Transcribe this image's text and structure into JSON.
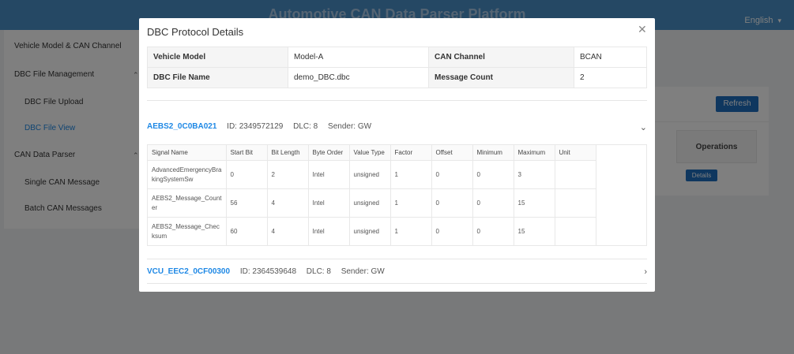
{
  "header": {
    "title": "Automotive CAN Data Parser Platform",
    "language": "English"
  },
  "sidebar": {
    "items": [
      {
        "label": "Vehicle Model & CAN Channel"
      },
      {
        "label": "DBC File Management"
      },
      {
        "label": "DBC File Upload"
      },
      {
        "label": "DBC File View"
      },
      {
        "label": "CAN Data Parser"
      },
      {
        "label": "Single CAN Message"
      },
      {
        "label": "Batch CAN Messages"
      }
    ]
  },
  "main": {
    "refresh_label": "Refresh",
    "operations_header": "Operations",
    "details_label": "Details"
  },
  "modal": {
    "title": "DBC Protocol Details",
    "info": {
      "vehicle_model_label": "Vehicle Model",
      "vehicle_model_value": "Model-A",
      "can_channel_label": "CAN Channel",
      "can_channel_value": "BCAN",
      "dbc_file_label": "DBC File Name",
      "dbc_file_value": "demo_DBC.dbc",
      "message_count_label": "Message Count",
      "message_count_value": "2"
    },
    "messages": [
      {
        "name": "AEBS2_0C0BA021",
        "id": "ID: 2349572129",
        "dlc": "DLC: 8",
        "sender": "Sender: GW"
      },
      {
        "name": "VCU_EEC2_0CF00300",
        "id": "ID: 2364539648",
        "dlc": "DLC: 8",
        "sender": "Sender: GW"
      }
    ],
    "signal_columns": [
      "Signal Name",
      "Start Bit",
      "Bit Length",
      "Byte Order",
      "Value Type",
      "Factor",
      "Offset",
      "Minimum",
      "Maximum",
      "Unit"
    ],
    "signals": [
      {
        "name1": "AdvancedEmergencyBra",
        "name2": "kingSystemSw",
        "start_bit": "0",
        "bit_length": "2",
        "byte_order": "Intel",
        "value_type": "unsigned",
        "factor": "1",
        "offset": "0",
        "minimum": "0",
        "maximum": "3",
        "unit": ""
      },
      {
        "name1": "AEBS2_Message_Count",
        "name2": "er",
        "start_bit": "56",
        "bit_length": "4",
        "byte_order": "Intel",
        "value_type": "unsigned",
        "factor": "1",
        "offset": "0",
        "minimum": "0",
        "maximum": "15",
        "unit": ""
      },
      {
        "name1": "AEBS2_Message_Chec",
        "name2": "ksum",
        "start_bit": "60",
        "bit_length": "4",
        "byte_order": "Intel",
        "value_type": "unsigned",
        "factor": "1",
        "offset": "0",
        "minimum": "0",
        "maximum": "15",
        "unit": ""
      }
    ]
  }
}
